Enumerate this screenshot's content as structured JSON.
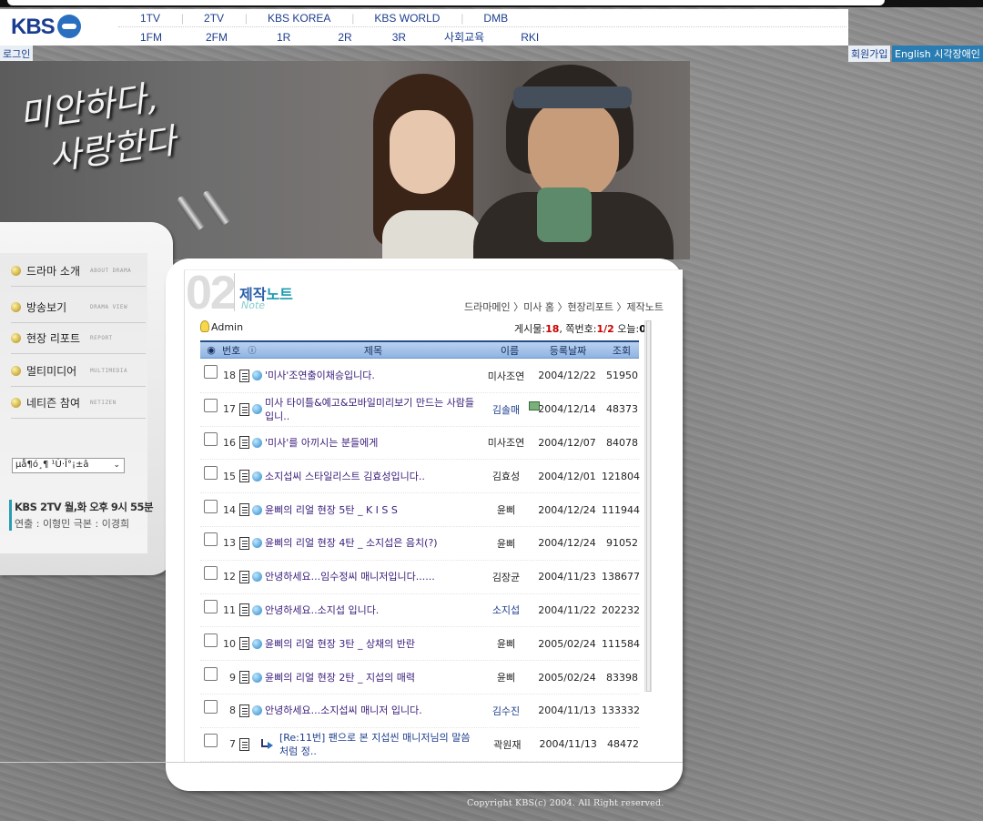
{
  "header": {
    "logo_text": "KBS",
    "nav_row1": [
      "1TV",
      "2TV",
      "KBS KOREA",
      "KBS WORLD",
      "DMB"
    ],
    "nav_row2": [
      "1FM",
      "2FM",
      "1R",
      "2R",
      "3R",
      "사회교육",
      "RKI"
    ],
    "login": "로그인",
    "signup": "회원가입",
    "english": "English 시각장애인"
  },
  "hero": {
    "title_line1": "미안하다,",
    "title_line2": "사랑한다"
  },
  "sidebar": {
    "items": [
      {
        "label": "드라마 소개",
        "en": "ABOUT DRAMA"
      },
      {
        "label": "방송보기",
        "en": "DRAMA VIEW"
      },
      {
        "label": "현장 리포트",
        "en": "REPORT"
      },
      {
        "label": "멀티미디어",
        "en": "MULTIMEDIA"
      },
      {
        "label": "네티즌 참여",
        "en": "NETIZEN"
      }
    ],
    "select_value": "µå¶ó¸¶ ¹Ù·Î°¡±â",
    "broadcast_time": "KBS 2TV 월,화 오후 9시 55분",
    "credits": "연출 : 이형민  극본 : 이경희"
  },
  "section": {
    "number": "02",
    "title_a": "제작",
    "title_b": "노트",
    "title_en": "Note",
    "breadcrumb": "드라마메인 〉미사 홈 〉현장리포트 〉제작노트"
  },
  "board": {
    "admin": "Admin",
    "stats_label": "게시물:",
    "stats_count": "18",
    "stats_page_label": ", 쪽번호:",
    "stats_page": "1/2",
    "stats_today_label": " 오늘:",
    "stats_today": "0",
    "columns": {
      "no": "번호",
      "subject": "제목",
      "name": "이름",
      "date": "등록날짜",
      "views": "조회"
    },
    "rows": [
      {
        "no": "18",
        "subject": "'미사'조연출이채승입니다.",
        "name": "미사조연",
        "date": "2004/12/22",
        "views": "51950",
        "link": false
      },
      {
        "no": "17",
        "subject": "미사 타이틀&예고&모바일미리보기 만드는 사람들입니..",
        "name": "김솔매",
        "date": "2004/12/14",
        "views": "48373",
        "link": true
      },
      {
        "no": "16",
        "subject": "'미사'를 아끼시는 분들에게",
        "name": "미사조연",
        "date": "2004/12/07",
        "views": "84078",
        "link": false
      },
      {
        "no": "15",
        "subject": "소지섭씨 스타일리스트 김효성입니다..",
        "name": "김효성",
        "date": "2004/12/01",
        "views": "121804",
        "link": false
      },
      {
        "no": "14",
        "subject": "윤삐의 리얼 현장 5탄 _ K I S S",
        "name": "윤삐",
        "date": "2004/12/24",
        "views": "111944",
        "link": false
      },
      {
        "no": "13",
        "subject": "윤삐의 리얼 현장 4탄 _ 소지섭은 음치(?)",
        "name": "윤삐",
        "date": "2004/12/24",
        "views": "91052",
        "link": false
      },
      {
        "no": "12",
        "subject": "안녕하세요...임수정씨 매니저입니다......",
        "name": "김장균",
        "date": "2004/11/23",
        "views": "138677",
        "link": false
      },
      {
        "no": "11",
        "subject": "안녕하세요..소지섭 입니다.",
        "name": "소지섭",
        "date": "2004/11/22",
        "views": "202232",
        "link": true
      },
      {
        "no": "10",
        "subject": "윤삐의 리얼 현장 3탄 _ 상채의 반란",
        "name": "윤삐",
        "date": "2005/02/24",
        "views": "111584",
        "link": false
      },
      {
        "no": "9",
        "subject": "윤삐의 리얼 현장 2탄 _ 지섭의 매력",
        "name": "윤삐",
        "date": "2005/02/24",
        "views": "83398",
        "link": false
      },
      {
        "no": "8",
        "subject": "안녕하세요...소지섭씨 매니저 입니다.",
        "name": "김수진",
        "date": "2004/11/13",
        "views": "133332",
        "link": true
      },
      {
        "no": "7",
        "subject": "[Re:11번] 팬으로 본 지섭씬 매니저님의 말씀 처럼 정..",
        "name": "곽원재",
        "date": "2004/11/13",
        "views": "48472",
        "link": false
      }
    ]
  },
  "footer": {
    "copyright": "Copyright KBS(c) 2004. All Right reserved."
  }
}
